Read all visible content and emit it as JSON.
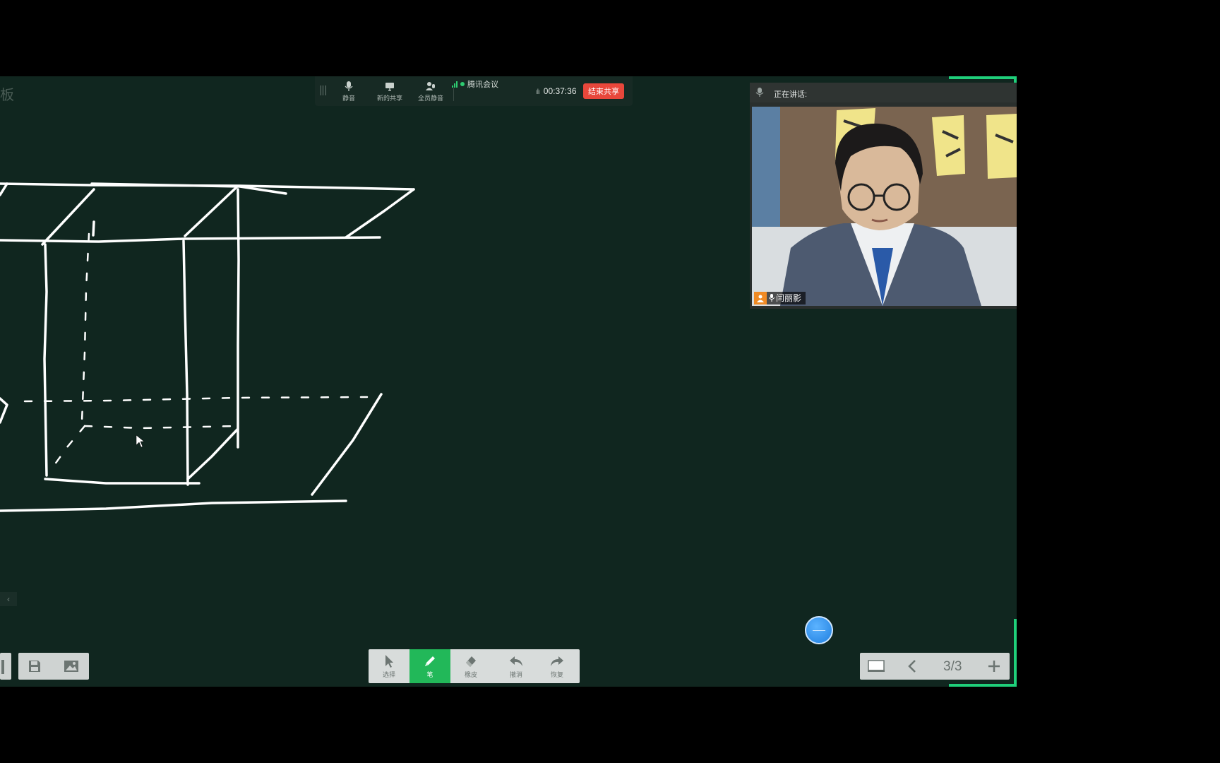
{
  "share_toolbar": {
    "mute_label": "静音",
    "new_share_label": "新的共享",
    "mute_all_label": "全员静音",
    "meeting_name": "腾讯会议",
    "timer": "00:37:36",
    "end_share_label": "结束共享"
  },
  "speaker_panel": {
    "speaking_label": "正在讲话:",
    "participant_name": "闫丽影"
  },
  "whiteboard": {
    "edge_glyph": "板",
    "collapse_arrow": "‹"
  },
  "tools": [
    {
      "label": "选择",
      "icon": "cursor-icon"
    },
    {
      "label": "笔",
      "icon": "pen-icon"
    },
    {
      "label": "橡皮",
      "icon": "eraser-icon"
    },
    {
      "label": "撤消",
      "icon": "undo-icon"
    },
    {
      "label": "恢复",
      "icon": "redo-icon"
    }
  ],
  "active_tool": "笔",
  "page_control": {
    "page_indicator": "3/3"
  },
  "colors": {
    "board": "#10261f",
    "accent_green": "#22b859",
    "end_share_red": "#e8473b",
    "floating_ball_blue": "#2f8ff0"
  }
}
